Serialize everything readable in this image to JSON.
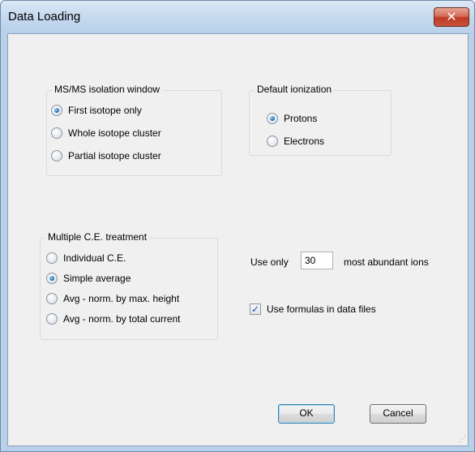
{
  "window": {
    "title": "Data Loading",
    "close_label": "✕"
  },
  "msms_group": {
    "label": "MS/MS isolation window",
    "options": [
      {
        "label": "First isotope only",
        "checked": true
      },
      {
        "label": "Whole isotope cluster",
        "checked": false
      },
      {
        "label": "Partial isotope cluster",
        "checked": false
      }
    ]
  },
  "ionization_group": {
    "label": "Default ionization",
    "options": [
      {
        "label": "Protons",
        "checked": true
      },
      {
        "label": "Electrons",
        "checked": false
      }
    ]
  },
  "ce_group": {
    "label": "Multiple C.E. treatment",
    "options": [
      {
        "label": "Individual C.E.",
        "checked": false
      },
      {
        "label": "Simple average",
        "checked": true
      },
      {
        "label": "Avg - norm. by max. height",
        "checked": false
      },
      {
        "label": "Avg - norm. by total current",
        "checked": false
      }
    ]
  },
  "ions": {
    "prefix": "Use only",
    "value": "30",
    "suffix": "most abundant ions"
  },
  "formulas": {
    "label": "Use formulas in data files",
    "checked": true,
    "check_glyph": "✓"
  },
  "buttons": {
    "ok": "OK",
    "cancel": "Cancel"
  },
  "colors": {
    "title_bar": "#c5d9ef",
    "close_button": "#c9523d",
    "client": "#f0f0f0",
    "radio_dot": "#2a7ab8"
  }
}
